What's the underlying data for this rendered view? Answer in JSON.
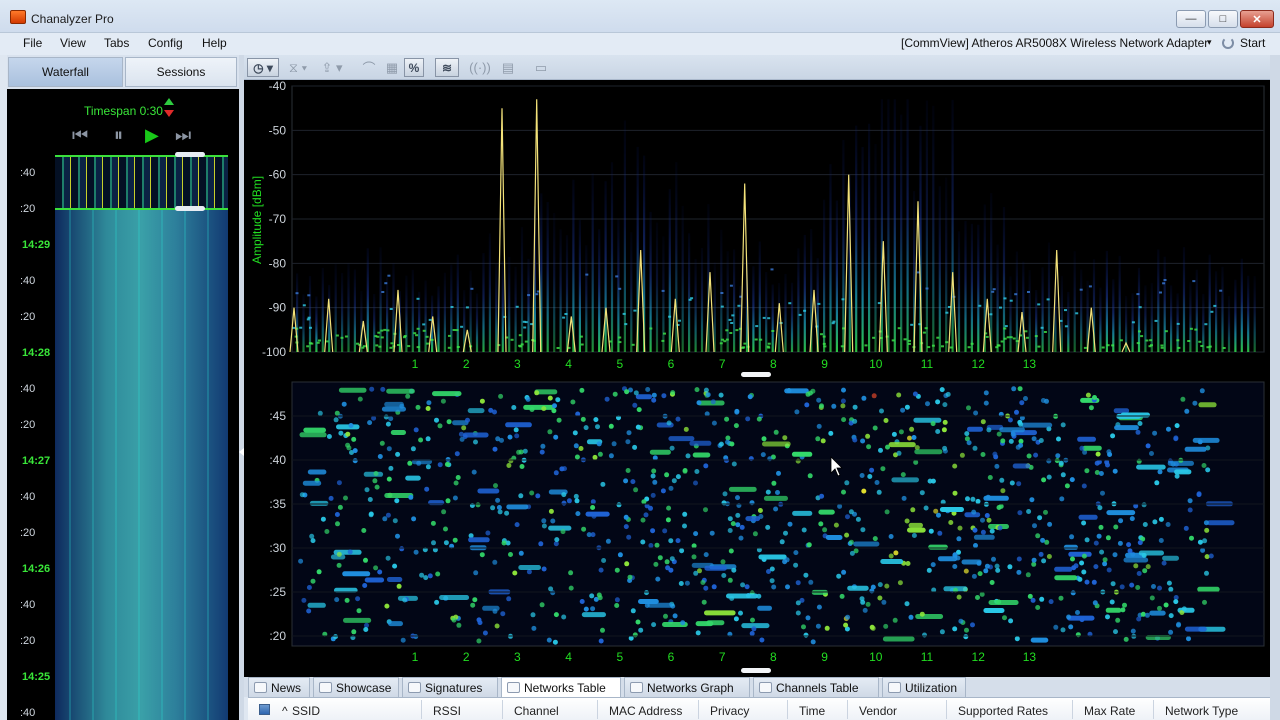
{
  "window": {
    "title": "Chanalyzer Pro",
    "min": "—",
    "max": "□",
    "close": "✕",
    "brand_color": "#e05a10"
  },
  "menu": [
    "File",
    "View",
    "Tabs",
    "Config",
    "Help"
  ],
  "adapter": {
    "label": "[CommView] Atheros AR5008X Wireless Network Adapter",
    "arrow": "▾",
    "start": "Start"
  },
  "left_panel": {
    "tabs": [
      "Waterfall",
      "Sessions"
    ],
    "timespan": "Timespan 0:30",
    "playback": {
      "prev": "⏮",
      "pause": "⏸",
      "play": "▶",
      "next": "⏭"
    },
    "time_labels": [
      ":40",
      ":20",
      "14:29",
      ":40",
      ":20",
      "14:28",
      ":40",
      ":20",
      "14:27",
      ":40",
      ":20",
      "14:26",
      ":40",
      ":20",
      "14:25",
      ":40"
    ],
    "major_time_labels": [
      "14:29",
      "14:28",
      "14:27",
      "14:26",
      "14:25"
    ]
  },
  "toolbar": {
    "percent": "%"
  },
  "chart_data": [
    {
      "type": "line",
      "title": "",
      "ylabel": "Amplitude [dBm]",
      "xlabel": "",
      "ylim": [
        -100,
        -40
      ],
      "y_ticks": [
        "-40",
        "-50",
        "-60",
        "-70",
        "-80",
        "-90",
        "-100"
      ],
      "x_ticks": [
        "1",
        "2",
        "3",
        "4",
        "5",
        "6",
        "7",
        "8",
        "9",
        "10",
        "11",
        "12",
        "13"
      ],
      "series": [
        {
          "values": [
            -90,
            -88,
            -93,
            -86,
            -92,
            -95,
            -45,
            -43,
            -92,
            -90,
            -77,
            -88,
            -82,
            -62,
            -89,
            -86,
            -60,
            -75,
            -66,
            -82,
            -88,
            -91,
            -77,
            -90,
            -98
          ]
        }
      ],
      "colors": {
        "peaks": "#f3e27a",
        "density_low": "#0b1f8a",
        "density_mid": "#23c8e0",
        "density_high": "#39e639"
      },
      "grid": true
    },
    {
      "type": "heatmap",
      "title": "",
      "y_ticks": [
        ":45",
        ":40",
        ":35",
        ":30",
        ":25",
        ":20"
      ],
      "x_ticks": [
        "1",
        "2",
        "3",
        "4",
        "5",
        "6",
        "7",
        "8",
        "9",
        "10",
        "11",
        "12",
        "13"
      ]
    }
  ],
  "bottom_tabs": [
    {
      "label": "News",
      "active": false
    },
    {
      "label": "Showcase",
      "active": false
    },
    {
      "label": "Signatures",
      "active": false
    },
    {
      "label": "Networks Table",
      "active": true
    },
    {
      "label": "Networks Graph",
      "active": false
    },
    {
      "label": "Channels Table",
      "active": false
    },
    {
      "label": "Utilization",
      "active": false
    }
  ],
  "table_columns": [
    "SSID",
    "RSSI",
    "Channel",
    "MAC Address",
    "Privacy",
    "Time",
    "Vendor",
    "Supported Rates",
    "Max Rate",
    "Network Type"
  ],
  "sort_indicator": "^"
}
